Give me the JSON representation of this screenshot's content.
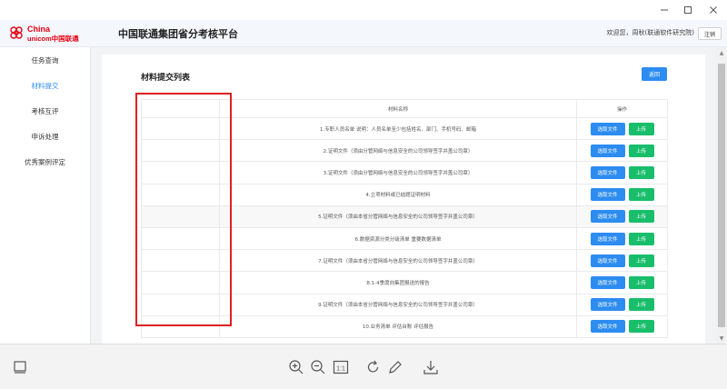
{
  "window": {
    "controls": [
      "minimize-icon",
      "maximize-icon",
      "close-icon"
    ]
  },
  "header": {
    "logo_text_top": "China",
    "logo_text_bottom": "unicom中国联通",
    "title": "中国联通集团省分考核平台",
    "welcome": "欢迎您，周秋(联通软件研究院)",
    "logout_label": "注销"
  },
  "sidebar": {
    "items": [
      {
        "label": "任务查询",
        "active": false
      },
      {
        "label": "材料提交",
        "active": true
      },
      {
        "label": "考核互评",
        "active": false
      },
      {
        "label": "申诉处理",
        "active": false
      },
      {
        "label": "优秀案例评定",
        "active": false
      }
    ]
  },
  "main": {
    "title": "材料提交列表",
    "back_label": "返回",
    "columns": [
      "",
      "材料名称",
      "操作"
    ],
    "select_label": "选取文件",
    "upload_label": "上传",
    "rows": [
      "1.专职人员名单 说明：人员名单至少包括姓名、部门、手机号码、邮箱",
      "2.证明文件（须由分管网络与信息安全的公司领导签字并盖公司章）",
      "3.证明文件（须由分管网络与信息安全的公司领导签字并盖公司章）",
      "4.立项材料或已结题证明材料",
      "5.证明文件（须由本省分管网络与信息安全的公司领导签字并盖公司章）",
      "6.数据资源分类分级清单 重要数据清单",
      "7.证明文件（须由本省分管网络与信息安全的公司领导签字并盖公司章）",
      "8.1-4季度向集团报送的报告",
      "9.证明文件（须由本省分管网络与信息安全的公司领导签字并盖公司章）",
      "10.业务清单 评估台账 评估报告"
    ]
  },
  "toolbar": {
    "icons": [
      "layout-icon",
      "zoom-in-icon",
      "zoom-out-icon",
      "actual-size-icon",
      "rotate-icon",
      "edit-icon",
      "download-icon"
    ],
    "actual_size_label": "1:1"
  },
  "colors": {
    "primary": "#2d8cf0",
    "success": "#19be6b",
    "highlight": "#e02020",
    "brand_red": "#e60012"
  }
}
